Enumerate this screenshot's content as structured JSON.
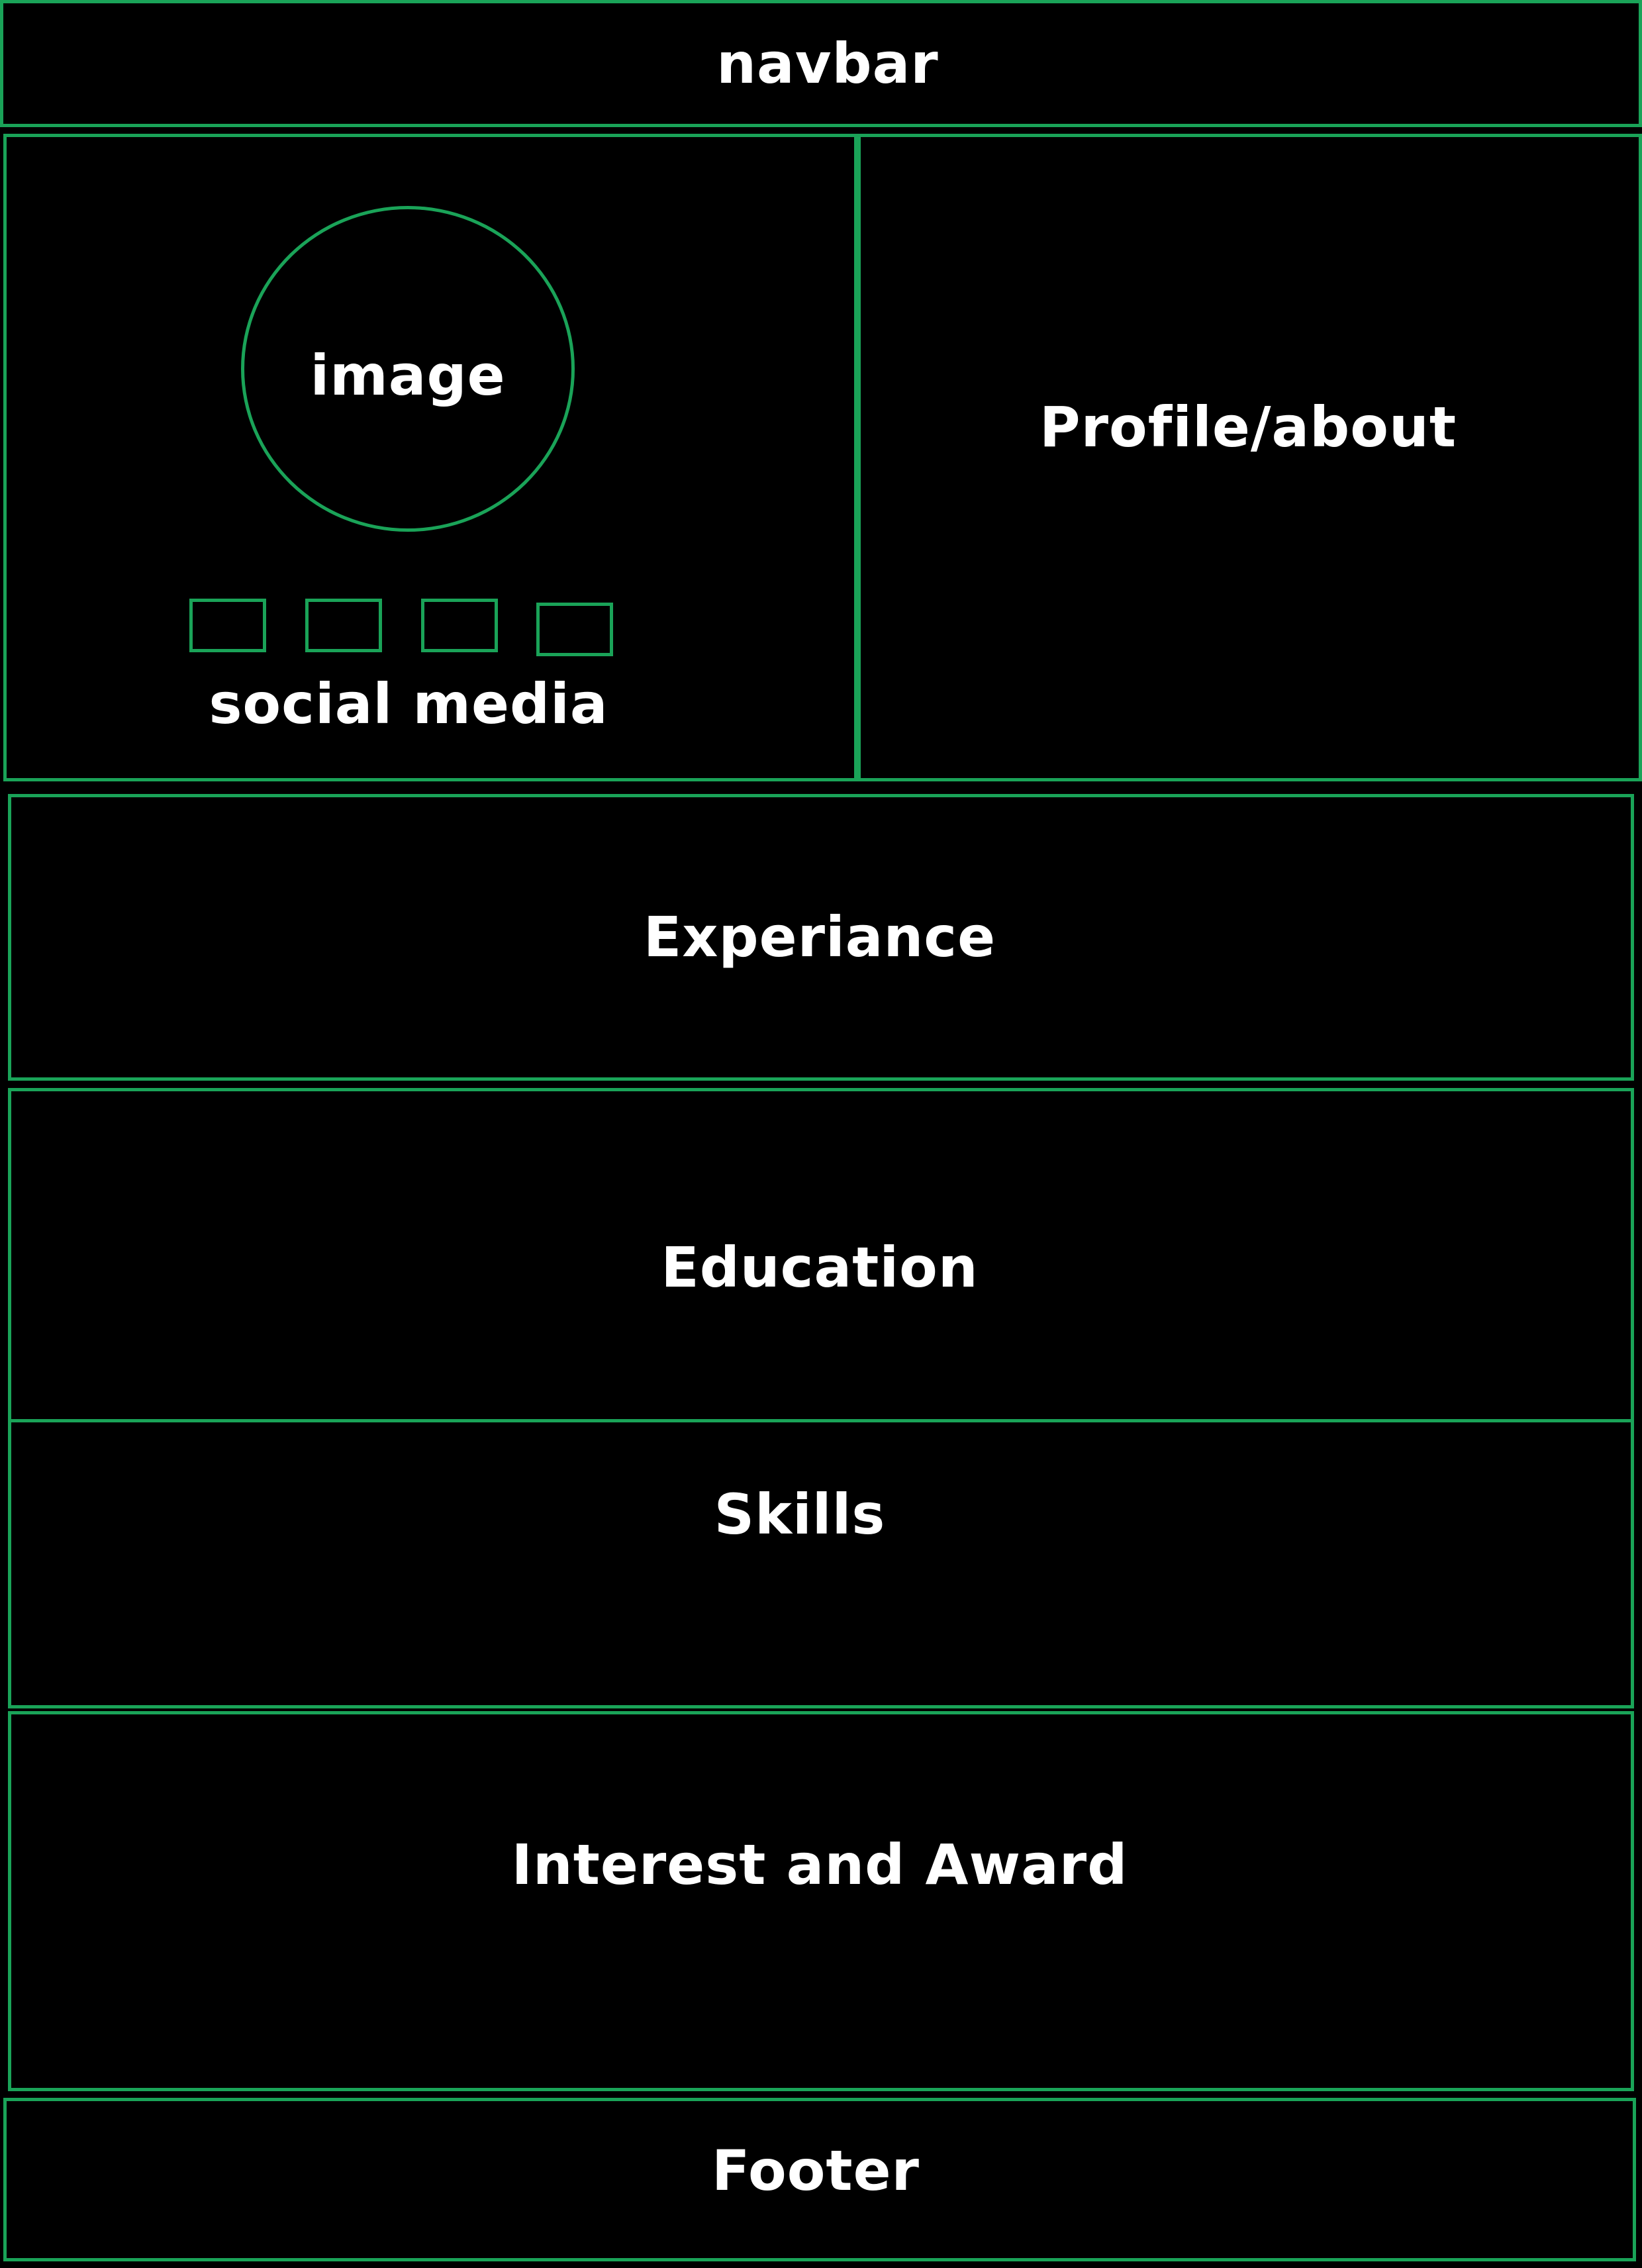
{
  "colors": {
    "background": "#000000",
    "outline": "#1aa358",
    "text": "#ffffff"
  },
  "navbar": {
    "label": "navbar"
  },
  "hero": {
    "image_label": "image",
    "social_label": "social media",
    "social_icons": [
      "placeholder-icon",
      "placeholder-icon",
      "placeholder-icon",
      "placeholder-icon"
    ],
    "profile_label": "Profile/about"
  },
  "sections": {
    "experience": "Experiance",
    "education": "Education",
    "skills": "Skills",
    "interest_award": "Interest and Award"
  },
  "footer": {
    "label": "Footer"
  }
}
